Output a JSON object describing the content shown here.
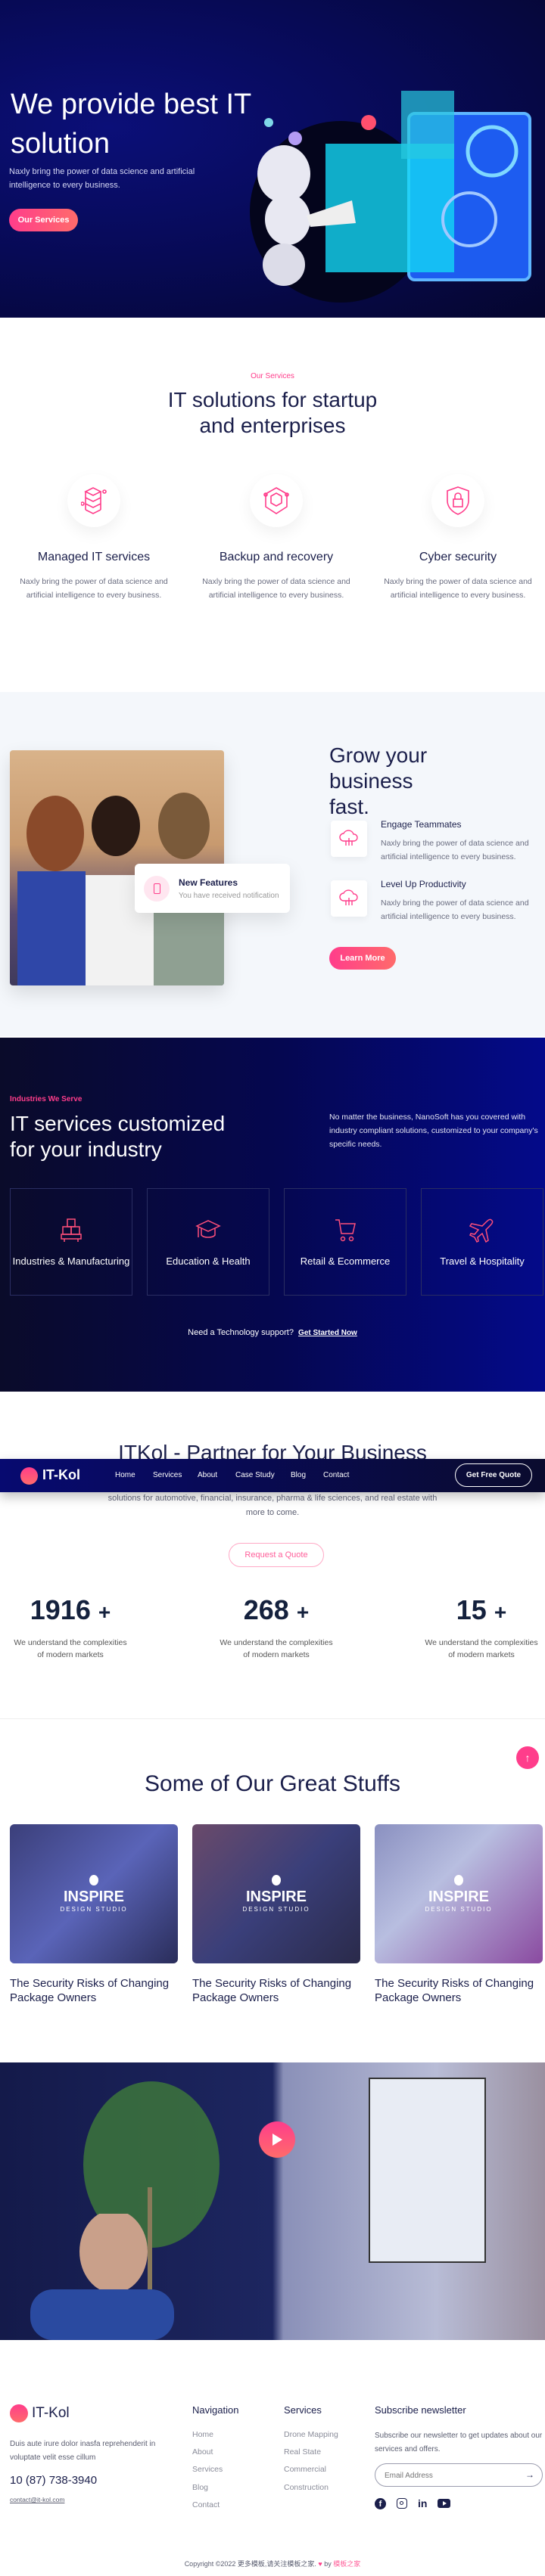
{
  "hero": {
    "title": "We provide best IT solution",
    "text": "Naxly bring the power of data science and artificial intelligence to every business.",
    "button": "Our Services"
  },
  "services": {
    "eyebrow": "Our Services",
    "title": "IT solutions for startup and enterprises",
    "items": [
      {
        "icon": "server-stack-icon",
        "title": "Managed IT services",
        "desc": "Naxly bring the power of data science and artificial intelligence to every business."
      },
      {
        "icon": "backup-cube-icon",
        "title": "Backup and recovery",
        "desc": "Naxly bring the power of data science and artificial intelligence to every business."
      },
      {
        "icon": "shield-lock-icon",
        "title": "Cyber security",
        "desc": "Naxly bring the power of data science and artificial intelligence to every business."
      }
    ]
  },
  "grow": {
    "title": "Grow your business fast.",
    "notification": {
      "title": "New Features",
      "text": "You have received notification"
    },
    "features": [
      {
        "title": "Engage Teammates",
        "desc": "Naxly bring the power of data science and artificial intelligence to every business."
      },
      {
        "title": "Level Up Productivity",
        "desc": "Naxly bring the power of data science and artificial intelligence to every business."
      }
    ],
    "button": "Learn More"
  },
  "industries": {
    "eyebrow": "Industries We Serve",
    "title": "IT services customized for your industry",
    "text": "No matter the business, NanoSoft has you covered with industry compliant solutions, customized to your company's specific needs.",
    "cards": [
      {
        "icon": "boxes-icon",
        "label": "Industries & Manufacturing"
      },
      {
        "icon": "graduation-cap-icon",
        "label": "Education & Health"
      },
      {
        "icon": "cart-icon",
        "label": "Retail & Ecommerce"
      },
      {
        "icon": "plane-icon",
        "label": "Travel & Hospitality"
      }
    ],
    "support": "Need a Technology support?",
    "support_link": "Get Started Now"
  },
  "nav": {
    "brand": "IT-Kol",
    "items": [
      "Home",
      "Services",
      "About",
      "Case Study",
      "Blog",
      "Contact"
    ],
    "cta": "Get Free Quote"
  },
  "partner": {
    "title": "ITKol - Partner for Your Business",
    "text": "solutions for automotive, financial, insurance, pharma & life sciences, and real estate with more to come.",
    "button": "Request a Quote",
    "stats": [
      {
        "value": "1916",
        "suffix": "+",
        "desc": "We understand the complexities of modern markets"
      },
      {
        "value": "268",
        "suffix": "+",
        "desc": "We understand the complexities of modern markets"
      },
      {
        "value": "15",
        "suffix": "+",
        "desc": "We understand the complexities of modern markets"
      }
    ]
  },
  "stuffs": {
    "title": "Some of Our Great Stuffs",
    "posts": [
      {
        "brand": "INSPIRE",
        "brand_sub": "DESIGN STUDIO",
        "title": "The Security Risks of Changing Package Owners"
      },
      {
        "brand": "INSPIRE",
        "brand_sub": "DESIGN STUDIO",
        "title": "The Security Risks of Changing Package Owners"
      },
      {
        "brand": "INSPIRE",
        "brand_sub": "DESIGN STUDIO",
        "title": "The Security Risks of Changing Package Owners"
      }
    ]
  },
  "footer": {
    "brand": "IT-Kol",
    "desc": "Duis aute irure dolor inasfa reprehenderit in voluptate velit esse cillum",
    "phone": "10 (87) 738-3940",
    "email": "contact@it-kol.com",
    "nav_title": "Navigation",
    "nav": [
      "Home",
      "About",
      "Services",
      "Blog",
      "Contact"
    ],
    "services_title": "Services",
    "services": [
      "Drone Mapping",
      "Real State",
      "Commercial",
      "Construction"
    ],
    "newsletter_title": "Subscribe newsletter",
    "newsletter_text": "Subscribe our newsletter to get updates about our services and offers.",
    "email_placeholder": "Email Address",
    "copyright": "Copyright ©2022 更多模板,请关注模板之家.",
    "by": "by",
    "by_link": "模板之家"
  },
  "colors": {
    "accent": "#ff3d8b",
    "navy": "#1b1f4b",
    "hero_bg": "#070a55"
  }
}
